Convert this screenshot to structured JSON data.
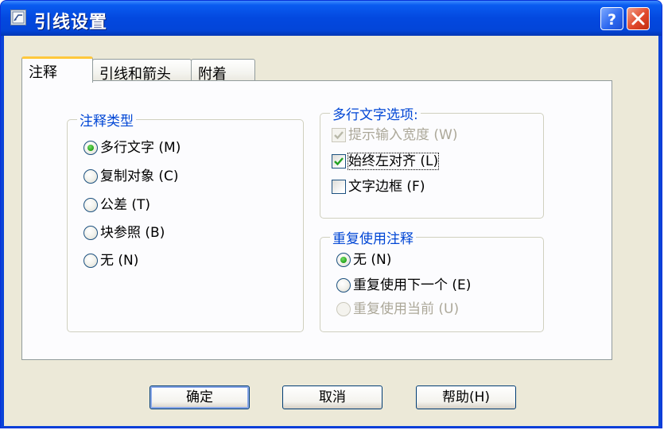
{
  "window": {
    "title": "引线设置",
    "help_label": "?",
    "close_label": "×"
  },
  "tabs": [
    {
      "label": "注释",
      "active": true
    },
    {
      "label": "引线和箭头",
      "active": false
    },
    {
      "label": "附着",
      "active": false
    }
  ],
  "annotation_type": {
    "title": "注释类型",
    "options": [
      {
        "label": "多行文字 (M)",
        "checked": true
      },
      {
        "label": "复制对象 (C)",
        "checked": false
      },
      {
        "label": "公差 (T)",
        "checked": false
      },
      {
        "label": "块参照 (B)",
        "checked": false
      },
      {
        "label": "无 (N)",
        "checked": false
      }
    ]
  },
  "mtext_options": {
    "title": "多行文字选项:",
    "options": [
      {
        "label": "提示输入宽度 (W)",
        "checked": true,
        "disabled": true
      },
      {
        "label": "始终左对齐 (L)",
        "checked": true,
        "disabled": false
      },
      {
        "label": "文字边框 (F)",
        "checked": false,
        "disabled": false
      }
    ]
  },
  "reuse_annotation": {
    "title": "重复使用注释",
    "options": [
      {
        "label": "无 (N)",
        "checked": true,
        "disabled": false
      },
      {
        "label": "重复使用下一个 (E)",
        "checked": false,
        "disabled": false
      },
      {
        "label": "重复使用当前 (U)",
        "checked": false,
        "disabled": true
      }
    ]
  },
  "buttons": {
    "ok": "确定",
    "cancel": "取消",
    "help": "帮助(H)"
  }
}
